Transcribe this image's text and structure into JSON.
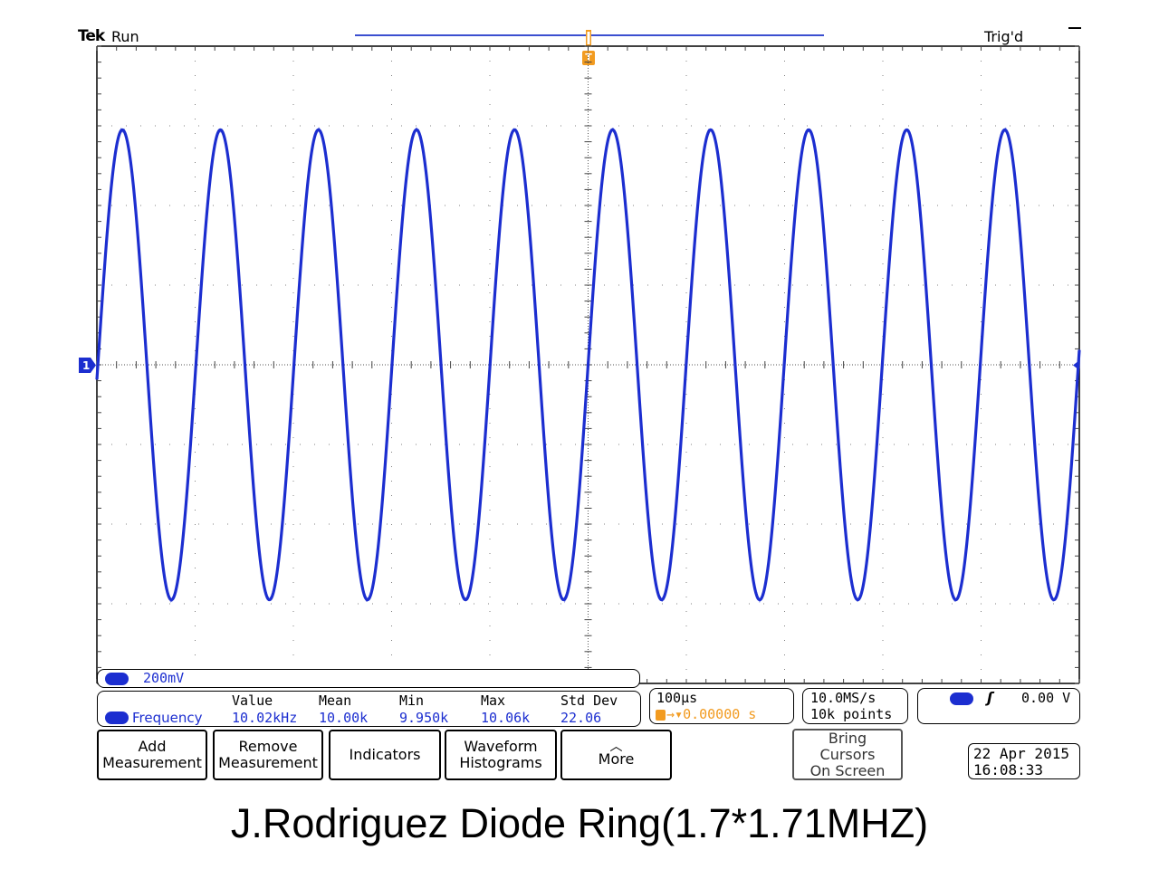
{
  "header": {
    "brand": "Tek",
    "acq_state": "Run",
    "trigger_status": "Trig'd"
  },
  "trigger_marker_label": "T",
  "channel_marker_label": "1",
  "colors": {
    "waveform": "#1c2ed0",
    "trigger": "#f29b20",
    "grid": "#808080",
    "record": "#3b4fd0"
  },
  "chart_data": {
    "type": "line",
    "title": "",
    "xlabel": "",
    "ylabel": "",
    "grid": true,
    "x_divisions": 10,
    "y_divisions": 8,
    "x_unit_per_div": "100µs",
    "y_unit_per_div": "200mV",
    "xlim": [
      -500,
      500
    ],
    "ylim": [
      -800,
      800
    ],
    "series": [
      {
        "channel": "1",
        "waveform": "sine",
        "frequency_khz": 10.02,
        "amplitude_mv": 590,
        "offset_mv": 0,
        "zero_crossing_x": 0
      }
    ]
  },
  "channel": {
    "number": "1",
    "scale": "200mV"
  },
  "measurement": {
    "name": "Frequency",
    "headers": [
      "Value",
      "Mean",
      "Min",
      "Max",
      "Std Dev"
    ],
    "values": [
      "10.02kHz",
      "10.00k",
      "9.950k",
      "10.06k",
      "22.06"
    ]
  },
  "timebase": {
    "scale": "100µs",
    "delay": "0.00000 s"
  },
  "acquisition": {
    "sample_rate": "10.0MS/s",
    "record_length": "10k points"
  },
  "trigger": {
    "source": "1",
    "slope_symbol": "ʃ",
    "level": "0.00 V"
  },
  "buttons": {
    "add": [
      "Add",
      "Measurement"
    ],
    "remove": [
      "Remove",
      "Measurement"
    ],
    "indicators": "Indicators",
    "waveform_histograms": [
      "Waveform",
      "Histograms"
    ],
    "more": "More",
    "bring_cursors": [
      "Bring",
      "Cursors",
      "On Screen"
    ]
  },
  "datetime": {
    "date": "22 Apr 2015",
    "time": "16:08:33"
  },
  "caption": "J.Rodriguez Diode Ring(1.7*1.71MHZ)"
}
